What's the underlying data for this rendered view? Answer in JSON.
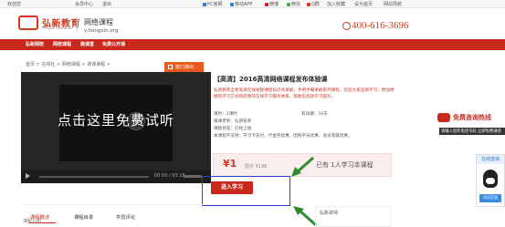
{
  "topbar": {
    "welcome": "欢迎您",
    "member": "会员中心",
    "logout": "退出",
    "links": [
      "PC官网",
      "移动APP",
      "微博",
      "微信",
      "Q群",
      "加入收藏",
      "设为首页",
      "网站导航"
    ],
    "accent": "#d43b1a"
  },
  "header": {
    "logo_cn": "弘新教育",
    "logo_en": "Hongxin Education",
    "site_name": "网络课程",
    "site_url": "v.hongxin.org",
    "phone": "400-616-3696"
  },
  "nav": {
    "items": [
      "弘新网校",
      "网校课程",
      "微课堂",
      "免费公开课"
    ],
    "color": "#c9281c"
  },
  "breadcrumb": "首页  >  在线社  >  网络课程  >  课课课程  >",
  "player": {
    "overlay": "点击这里免费试听",
    "time": "00:00 / 03:18",
    "popout": "窗口弹出"
  },
  "course": {
    "title": "【高清】2016高清网络课程发布体验课",
    "desc": "弘新教育全新高清在线视频课程知识点讲解，手把手细讲解系列课程，欢迎大家选择学习，更加便捷的学习方式和完善的在线学习服务体系，帮助您高效学习提升。",
    "hours_label": "课时：2课时",
    "validity_label": "有效期：10天",
    "teacher_label": "报课老师：弘新名师",
    "status_label": "课程状态：已经上线",
    "includes_label": "本课程不支持：学习卡支付、代金券优惠、团购学员优惠、会员等级优惠。",
    "price": "¥1",
    "orig_price": "原价 ¥198",
    "learners": "已有 1人学习本课程",
    "enroll": "进入学习"
  },
  "tabs": {
    "items": [
      "课程概述",
      "课程目录",
      "学员评论"
    ],
    "active_index": 0,
    "sub": "课程介绍"
  },
  "teacher_box": {
    "label": "弘新讲师"
  },
  "float_consult": {
    "title": "免费咨询热线",
    "sub": "请输入您的电话号码  立即免费通话"
  },
  "float_online": {
    "head": "在线咨询",
    "qq_button": "QQ交谈"
  }
}
